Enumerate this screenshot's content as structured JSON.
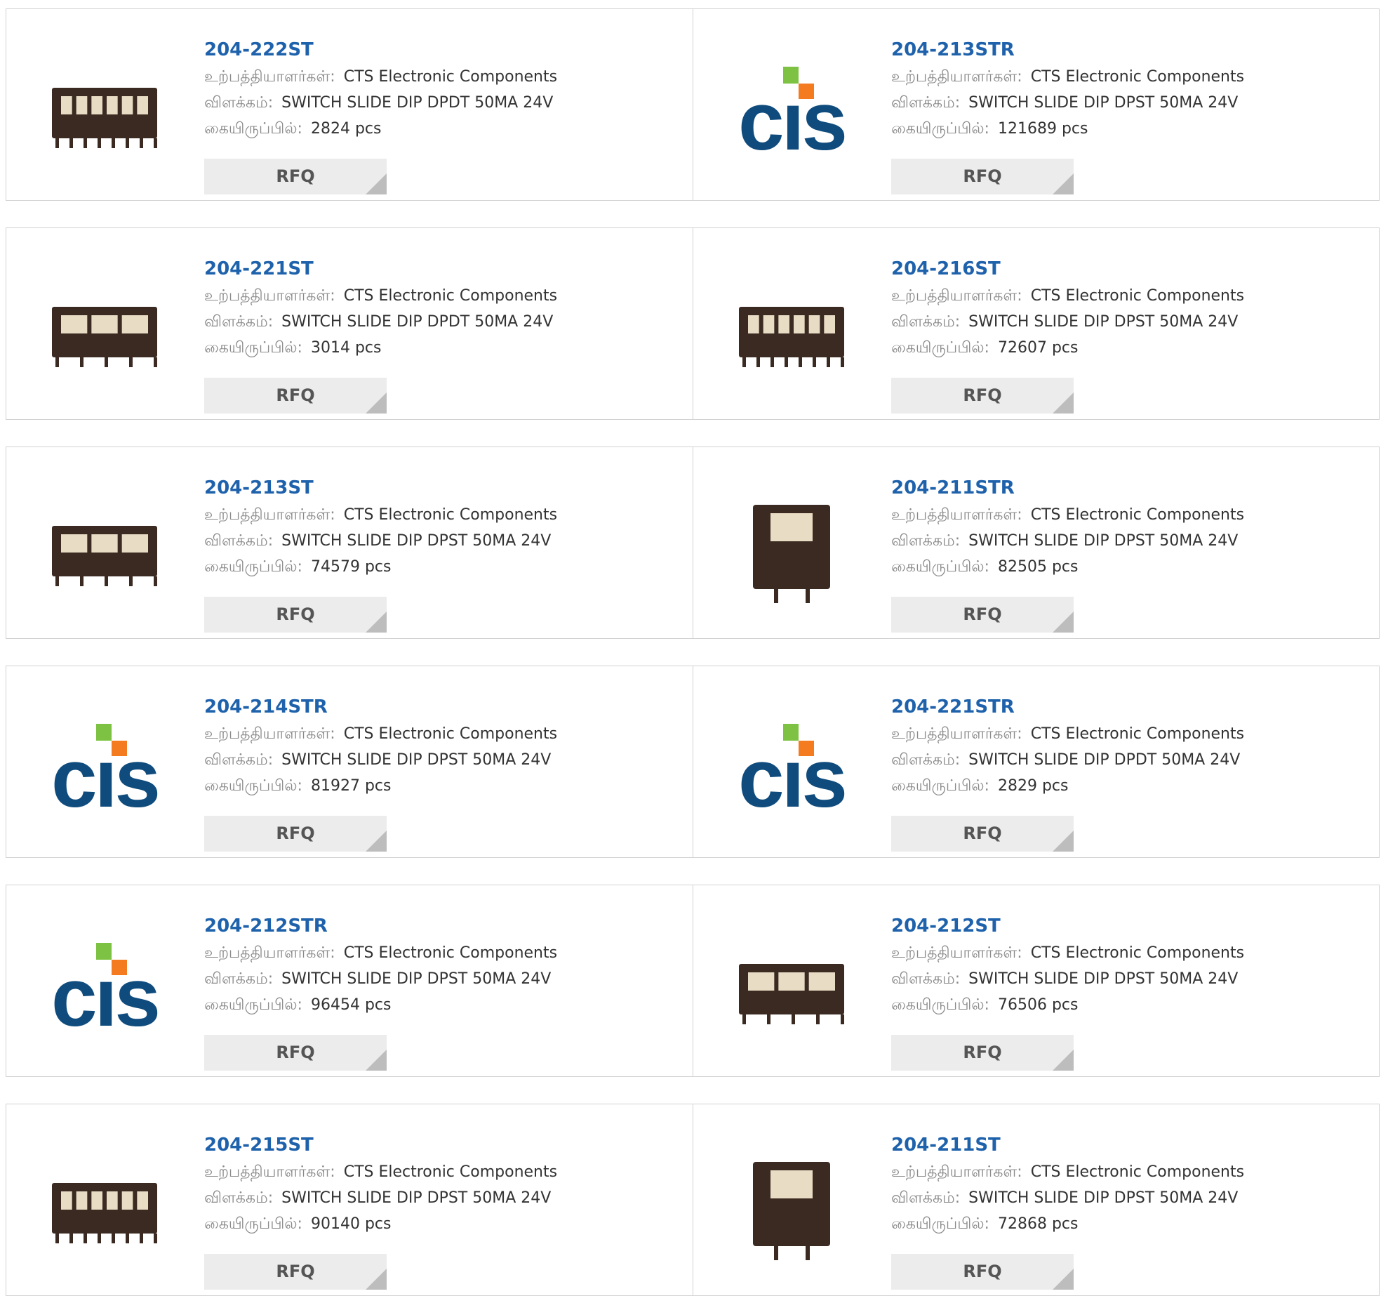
{
  "labels": {
    "manufacturer": "உற்பத்தியாளர்கள்:",
    "description": "விளக்கம்:",
    "stock": "கையிருப்பில்:",
    "rfq": "RFQ"
  },
  "colors": {
    "part_link": "#1f62ac",
    "cts_blue": "#0f4c7d",
    "cts_green": "#7dc242",
    "cts_orange": "#f47b20",
    "switch_body": "#3a2a22"
  },
  "products": [
    {
      "part": "204-222ST",
      "manufacturer": "CTS Electronic Components",
      "description": "SWITCH SLIDE DIP DPDT 50MA 24V",
      "stock": "2824 pcs",
      "image": "dip-switch-photo"
    },
    {
      "part": "204-213STR",
      "manufacturer": "CTS Electronic Components",
      "description": "SWITCH SLIDE DIP DPST 50MA 24V",
      "stock": "121689 pcs",
      "image": "cts-logo"
    },
    {
      "part": "204-221ST",
      "manufacturer": "CTS Electronic Components",
      "description": "SWITCH SLIDE DIP DPDT 50MA 24V",
      "stock": "3014 pcs",
      "image": "dip-switch-photo"
    },
    {
      "part": "204-216ST",
      "manufacturer": "CTS Electronic Components",
      "description": "SWITCH SLIDE DIP DPST 50MA 24V",
      "stock": "72607 pcs",
      "image": "dip-switch-photo"
    },
    {
      "part": "204-213ST",
      "manufacturer": "CTS Electronic Components",
      "description": "SWITCH SLIDE DIP DPST 50MA 24V",
      "stock": "74579 pcs",
      "image": "dip-switch-photo"
    },
    {
      "part": "204-211STR",
      "manufacturer": "CTS Electronic Components",
      "description": "SWITCH SLIDE DIP DPST 50MA 24V",
      "stock": "82505 pcs",
      "image": "dip-switch-photo"
    },
    {
      "part": "204-214STR",
      "manufacturer": "CTS Electronic Components",
      "description": "SWITCH SLIDE DIP DPST 50MA 24V",
      "stock": "81927 pcs",
      "image": "cts-logo"
    },
    {
      "part": "204-221STR",
      "manufacturer": "CTS Electronic Components",
      "description": "SWITCH SLIDE DIP DPDT 50MA 24V",
      "stock": "2829 pcs",
      "image": "cts-logo"
    },
    {
      "part": "204-212STR",
      "manufacturer": "CTS Electronic Components",
      "description": "SWITCH SLIDE DIP DPST 50MA 24V",
      "stock": "96454 pcs",
      "image": "cts-logo"
    },
    {
      "part": "204-212ST",
      "manufacturer": "CTS Electronic Components",
      "description": "SWITCH SLIDE DIP DPST 50MA 24V",
      "stock": "76506 pcs",
      "image": "dip-switch-photo"
    },
    {
      "part": "204-215ST",
      "manufacturer": "CTS Electronic Components",
      "description": "SWITCH SLIDE DIP DPST 50MA 24V",
      "stock": "90140 pcs",
      "image": "dip-switch-photo"
    },
    {
      "part": "204-211ST",
      "manufacturer": "CTS Electronic Components",
      "description": "SWITCH SLIDE DIP DPST 50MA 24V",
      "stock": "72868 pcs",
      "image": "dip-switch-photo"
    }
  ]
}
